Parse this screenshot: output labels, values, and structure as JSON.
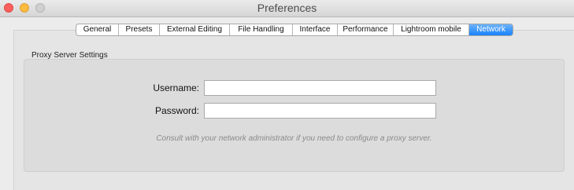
{
  "window": {
    "title": "Preferences"
  },
  "tabs": [
    {
      "label": "General"
    },
    {
      "label": "Presets"
    },
    {
      "label": "External Editing"
    },
    {
      "label": "File Handling"
    },
    {
      "label": "Interface"
    },
    {
      "label": "Performance"
    },
    {
      "label": "Lightroom mobile"
    },
    {
      "label": "Network",
      "active": true
    }
  ],
  "proxy": {
    "group_label": "Proxy Server Settings",
    "username_label": "Username:",
    "username_value": "",
    "password_label": "Password:",
    "password_value": "",
    "note": "Consult with your network administrator if you need to configure a proxy server."
  },
  "colors": {
    "active_tab": "#1a82fb",
    "close": "#fc605c",
    "minimize": "#fdbc40",
    "zoom_disabled": "#d0d0d0"
  }
}
